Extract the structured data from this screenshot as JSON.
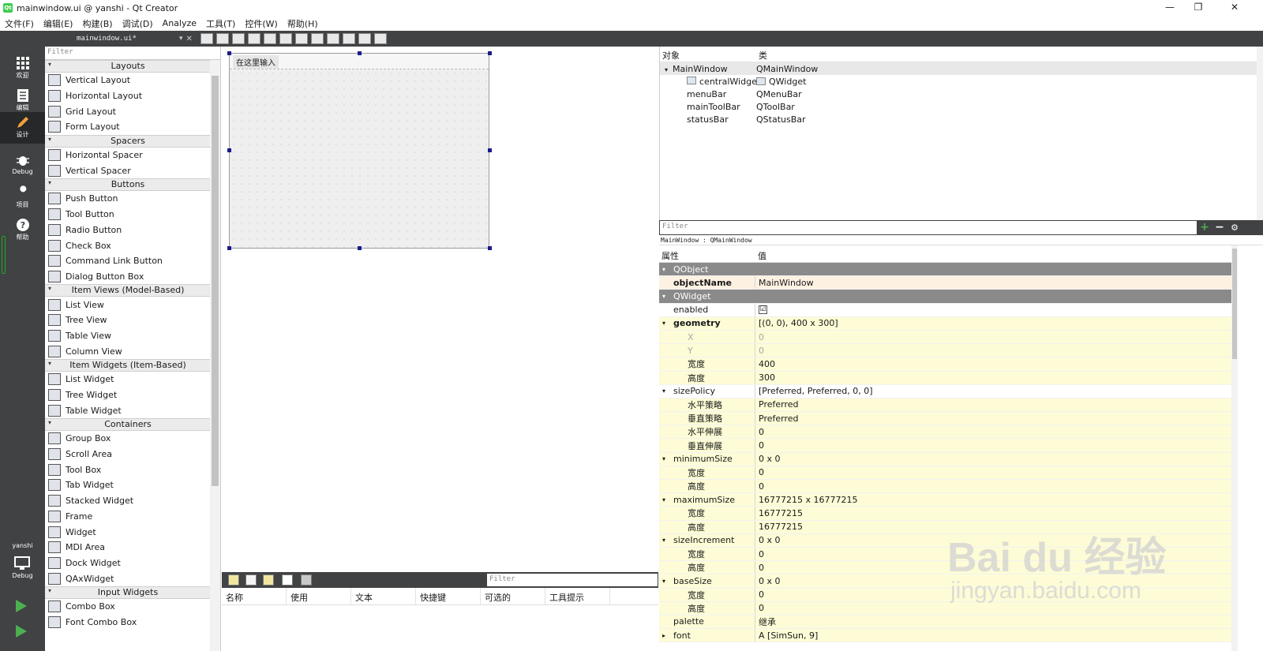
{
  "window": {
    "title": "mainwindow.ui @ yanshi - Qt Creator",
    "app_icon_text": "Qt",
    "controls": [
      "—",
      "❐",
      "✕"
    ]
  },
  "menu": [
    "文件(F)",
    "编辑(E)",
    "构建(B)",
    "调试(D)",
    "Analyze",
    "工具(T)",
    "控件(W)",
    "帮助(H)"
  ],
  "modes": [
    {
      "label": "欢迎",
      "icon": "grid-icon"
    },
    {
      "label": "编辑",
      "icon": "document-icon"
    },
    {
      "label": "设计",
      "icon": "pencil-icon"
    },
    {
      "label": "Debug",
      "icon": "bug-icon"
    },
    {
      "label": "项目",
      "icon": "wrench-icon"
    },
    {
      "label": "帮助",
      "icon": "help-icon"
    }
  ],
  "kit": {
    "project": "yanshi",
    "config": "Debug"
  },
  "doc": {
    "name": "mainwindow.ui*"
  },
  "widgetbox": {
    "filter_placeholder": "Filter",
    "categories": [
      {
        "title": "Layouts",
        "items": [
          "Vertical Layout",
          "Horizontal Layout",
          "Grid Layout",
          "Form Layout"
        ]
      },
      {
        "title": "Spacers",
        "items": [
          "Horizontal Spacer",
          "Vertical Spacer"
        ]
      },
      {
        "title": "Buttons",
        "items": [
          "Push Button",
          "Tool Button",
          "Radio Button",
          "Check Box",
          "Command Link Button",
          "Dialog Button Box"
        ]
      },
      {
        "title": "Item Views (Model-Based)",
        "items": [
          "List View",
          "Tree View",
          "Table View",
          "Column View"
        ]
      },
      {
        "title": "Item Widgets (Item-Based)",
        "items": [
          "List Widget",
          "Tree Widget",
          "Table Widget"
        ]
      },
      {
        "title": "Containers",
        "items": [
          "Group Box",
          "Scroll Area",
          "Tool Box",
          "Tab Widget",
          "Stacked Widget",
          "Frame",
          "Widget",
          "MDI Area",
          "Dock Widget",
          "QAxWidget"
        ]
      },
      {
        "title": "Input Widgets",
        "items": [
          "Combo Box",
          "Font Combo Box"
        ]
      }
    ]
  },
  "form": {
    "menu_placeholder": "在这里输入"
  },
  "action_editor": {
    "filter_placeholder": "Filter",
    "columns": [
      "名称",
      "使用",
      "文本",
      "快捷键",
      "可选的",
      "工具提示"
    ]
  },
  "object_inspector": {
    "columns": [
      "对象",
      "类"
    ],
    "rows": [
      {
        "name": "MainWindow",
        "cls": "QMainWindow"
      },
      {
        "name": "centralWidget",
        "cls": "QWidget"
      },
      {
        "name": "menuBar",
        "cls": "QMenuBar"
      },
      {
        "name": "mainToolBar",
        "cls": "QToolBar"
      },
      {
        "name": "statusBar",
        "cls": "QStatusBar"
      }
    ]
  },
  "property_editor": {
    "filter_placeholder": "Filter",
    "class_line": "MainWindow : QMainWindow",
    "columns": [
      "属性",
      "值"
    ],
    "rows": [
      {
        "t": "sect",
        "n": "QObject",
        "v": ""
      },
      {
        "t": "peach bold",
        "n": "objectName",
        "v": "MainWindow"
      },
      {
        "t": "sect",
        "n": "QWidget",
        "v": ""
      },
      {
        "t": "plain",
        "n": "enabled",
        "v": "☑"
      },
      {
        "t": "yellow bold",
        "n": "geometry",
        "v": "[(0, 0), 400 x 300]"
      },
      {
        "t": "yellow sub dis",
        "n": "X",
        "v": "0"
      },
      {
        "t": "yellow sub dis",
        "n": "Y",
        "v": "0"
      },
      {
        "t": "yellow sub",
        "n": "宽度",
        "v": "400"
      },
      {
        "t": "yellow sub",
        "n": "高度",
        "v": "300"
      },
      {
        "t": "plain",
        "n": "sizePolicy",
        "v": "[Preferred, Preferred, 0, 0]"
      },
      {
        "t": "yellow sub",
        "n": "水平策略",
        "v": "Preferred"
      },
      {
        "t": "yellow sub",
        "n": "垂直策略",
        "v": "Preferred"
      },
      {
        "t": "yellow sub",
        "n": "水平伸展",
        "v": "0"
      },
      {
        "t": "yellow sub",
        "n": "垂直伸展",
        "v": "0"
      },
      {
        "t": "yellow",
        "n": "minimumSize",
        "v": "0 x 0"
      },
      {
        "t": "yellow sub",
        "n": "宽度",
        "v": "0"
      },
      {
        "t": "yellow sub",
        "n": "高度",
        "v": "0"
      },
      {
        "t": "yellow",
        "n": "maximumSize",
        "v": "16777215 x 16777215"
      },
      {
        "t": "yellow sub",
        "n": "宽度",
        "v": "16777215"
      },
      {
        "t": "yellow sub",
        "n": "高度",
        "v": "16777215"
      },
      {
        "t": "yellow",
        "n": "sizeIncrement",
        "v": "0 x 0"
      },
      {
        "t": "yellow sub",
        "n": "宽度",
        "v": "0"
      },
      {
        "t": "yellow sub",
        "n": "高度",
        "v": "0"
      },
      {
        "t": "yellow",
        "n": "baseSize",
        "v": "0 x 0"
      },
      {
        "t": "yellow sub",
        "n": "宽度",
        "v": "0"
      },
      {
        "t": "yellow sub",
        "n": "高度",
        "v": "0"
      },
      {
        "t": "yellow",
        "n": "palette",
        "v": "继承"
      },
      {
        "t": "yellow",
        "n": "font",
        "v": "A  [SimSun, 9]"
      }
    ]
  },
  "watermark": {
    "logo": "Bai du 经验",
    "url": "jingyan.baidu.com"
  }
}
